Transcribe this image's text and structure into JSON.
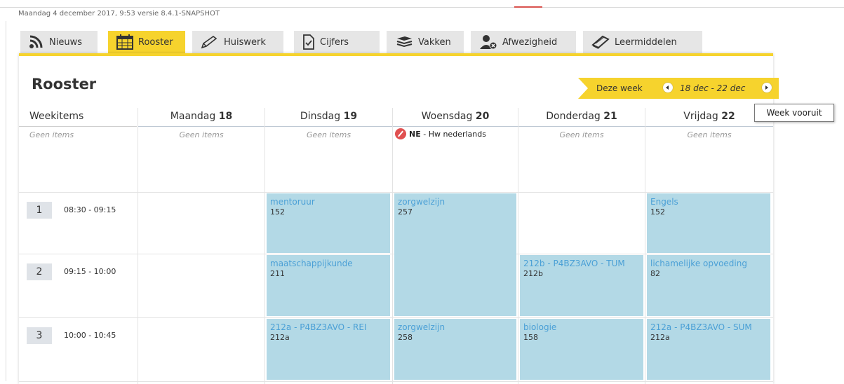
{
  "status_line": "Maandag 4 december 2017, 9:53 versie 8.4.1-SNAPSHOT",
  "tabs": [
    {
      "label": "Nieuws",
      "icon": "rss-icon"
    },
    {
      "label": "Rooster",
      "icon": "calendar-icon",
      "active": true
    },
    {
      "label": "Huiswerk",
      "icon": "pencil-icon"
    },
    {
      "label": "Cijfers",
      "icon": "document-check-icon"
    },
    {
      "label": "Vakken",
      "icon": "books-icon"
    },
    {
      "label": "Afwezigheid",
      "icon": "user-absent-icon"
    },
    {
      "label": "Leermiddelen",
      "icon": "book-icon"
    }
  ],
  "page_title": "Rooster",
  "week_nav": {
    "this_week": "Deze week",
    "range": "18 dec - 22 dec"
  },
  "tooltip": "Week vooruit",
  "columns": {
    "weekitems": "Weekitems",
    "days": [
      {
        "name": "Maandag",
        "date": "18"
      },
      {
        "name": "Dinsdag",
        "date": "19"
      },
      {
        "name": "Woensdag",
        "date": "20"
      },
      {
        "name": "Donderdag",
        "date": "21"
      },
      {
        "name": "Vrijdag",
        "date": "22"
      }
    ]
  },
  "week_items": {
    "empty_label": "Geen items",
    "homework": {
      "code": "NE",
      "text": " - Hw nederlands"
    }
  },
  "hours": [
    {
      "num": "1",
      "time": "08:30 - 09:15"
    },
    {
      "num": "2",
      "time": "09:15 - 10:00"
    },
    {
      "num": "3",
      "time": "10:00 - 10:45"
    }
  ],
  "lessons": {
    "di1": {
      "subject": "mentoruur",
      "room": "152"
    },
    "wo1": {
      "subject": "zorgwelzijn",
      "room": "257"
    },
    "vr1": {
      "subject": "Engels",
      "room": "152"
    },
    "di2": {
      "subject": "maatschappijkunde",
      "room": "211"
    },
    "do2": {
      "subject": "212b - P4BZ3AVO - TUM",
      "room": "212b"
    },
    "vr2": {
      "subject": "lichamelijke opvoeding",
      "room": "82"
    },
    "di3": {
      "subject": "212a - P4BZ3AVO - REI",
      "room": "212a"
    },
    "wo3": {
      "subject": "zorgwelzijn",
      "room": "258"
    },
    "do3": {
      "subject": "biologie",
      "room": "158"
    },
    "vr3": {
      "subject": "212a - P4BZ3AVO - SUM",
      "room": "212a"
    }
  }
}
